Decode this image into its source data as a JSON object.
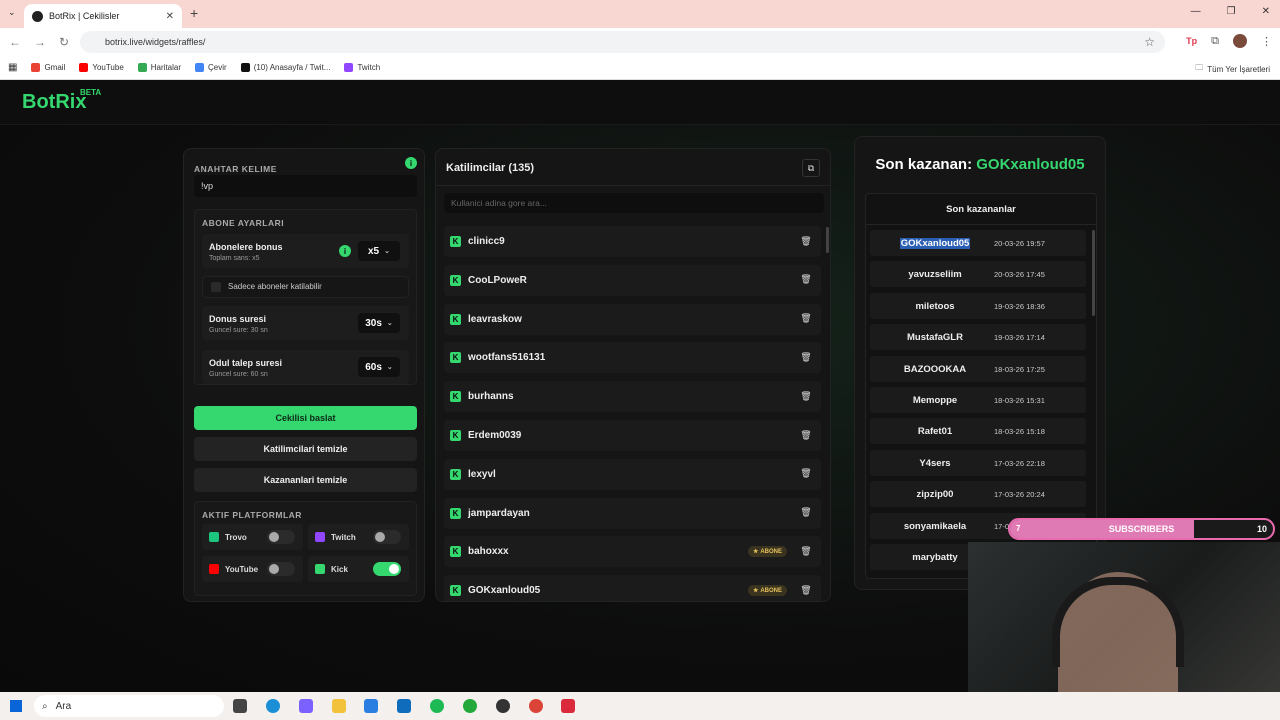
{
  "browser": {
    "tab_title": "BotRix | Cekilisler",
    "url": "botrix.live/widgets/raffles/",
    "bookmarks": [
      {
        "label": "Gmail",
        "color": "#ea4335"
      },
      {
        "label": "YouTube",
        "color": "#ff0000"
      },
      {
        "label": "Haritalar",
        "color": "#34a853"
      },
      {
        "label": "Çevir",
        "color": "#4285f4"
      },
      {
        "label": "(10) Anasayfa / Twit...",
        "color": "#111111"
      },
      {
        "label": "Twitch",
        "color": "#9146ff"
      }
    ],
    "bookmarks_right": "Tüm Yer İşaretleri"
  },
  "app": {
    "logo": "BotRix",
    "logo_badge": "BETA",
    "accent": "#35d76f"
  },
  "settings": {
    "keyword_label": "ANAHTAR KELIME",
    "keyword_value": "!vp",
    "sub_section_label": "ABONE AYARLARI",
    "sub_bonus": {
      "title": "Abonelere bonus",
      "subtitle": "Toplam sans: x5",
      "value": "x5"
    },
    "only_subs_label": "Sadece aboneler katilabilir",
    "bonus_time": {
      "title": "Donus suresi",
      "subtitle": "Guncel sure: 30 sn",
      "value": "30s"
    },
    "claim_time": {
      "title": "Odul talep suresi",
      "subtitle": "Guncel sure: 60 sn",
      "value": "60s"
    },
    "start_btn": "Cekilisi baslat",
    "clear_participants_btn": "Katilimcilari temizle",
    "clear_winners_btn": "Kazananlari temizle",
    "platforms_label": "AKTIF PLATFORMLAR",
    "platforms": [
      {
        "name": "Trovo",
        "color": "#1cc57e",
        "on": false
      },
      {
        "name": "Twitch",
        "color": "#9146ff",
        "on": false
      },
      {
        "name": "YouTube",
        "color": "#ff0000",
        "on": false
      },
      {
        "name": "Kick",
        "color": "#35d76f",
        "on": true
      }
    ]
  },
  "participants": {
    "title": "Katilimcilar (135)",
    "search_placeholder": "Kullanici adina gore ara...",
    "abone_label": "ABONE",
    "rows": [
      {
        "name": "clinicc9",
        "abone": false
      },
      {
        "name": "CooLPoweR",
        "abone": false
      },
      {
        "name": "leavraskow",
        "abone": false
      },
      {
        "name": "wootfans516131",
        "abone": false
      },
      {
        "name": "burhanns",
        "abone": false
      },
      {
        "name": "Erdem0039",
        "abone": false
      },
      {
        "name": "lexyvl",
        "abone": false
      },
      {
        "name": "jampardayan",
        "abone": false
      },
      {
        "name": "bahoxxx",
        "abone": true
      },
      {
        "name": "GOKxanloud05",
        "abone": true
      }
    ]
  },
  "winners": {
    "last_winner_label": "Son kazanan:",
    "last_winner_name": "GOKxanloud05",
    "list_title": "Son kazananlar",
    "rows": [
      {
        "name": "GOKxanloud05",
        "date": "20-03-26 19:57"
      },
      {
        "name": "yavuzseliim",
        "date": "20-03-26 17:45"
      },
      {
        "name": "miletoos",
        "date": "19-03-26 18:36"
      },
      {
        "name": "MustafaGLR",
        "date": "19-03-26 17:14"
      },
      {
        "name": "BAZOOOKAA",
        "date": "18-03-26 17:25"
      },
      {
        "name": "Memoppe",
        "date": "18-03-26 15:31"
      },
      {
        "name": "Rafet01",
        "date": "18-03-26 15:18"
      },
      {
        "name": "Y4sers",
        "date": "17-03-26 22:18"
      },
      {
        "name": "zipzip00",
        "date": "17-03-26 20:24"
      },
      {
        "name": "sonyamikaela",
        "date": "17-03-26"
      },
      {
        "name": "marybatty",
        "date": ""
      }
    ]
  },
  "overlay": {
    "subs_label": "SUBSCRIBERS",
    "subs_current": "7",
    "subs_goal": "10",
    "subs_progress": 0.7
  },
  "taskbar": {
    "search_placeholder": "Ara"
  }
}
